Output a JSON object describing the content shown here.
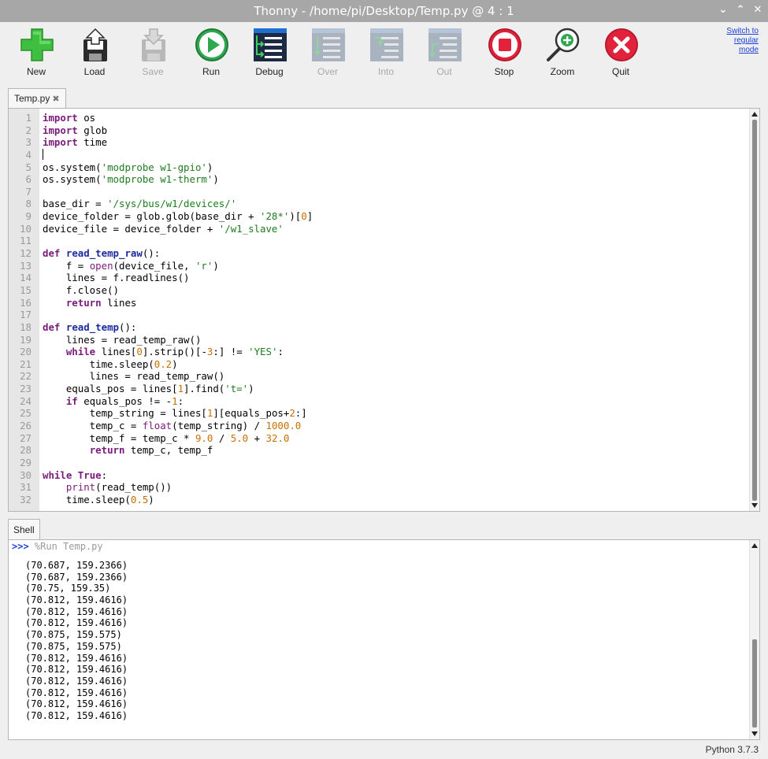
{
  "window": {
    "title": "Thonny  -  /home/pi/Desktop/Temp.py  @  4 : 1",
    "controls": [
      "⌄",
      "⌃",
      "✕"
    ]
  },
  "toolbar": {
    "buttons": [
      {
        "label": "New",
        "icon": "new-file-icon",
        "enabled": true
      },
      {
        "label": "Load",
        "icon": "load-icon",
        "enabled": true
      },
      {
        "label": "Save",
        "icon": "save-icon",
        "enabled": false
      },
      {
        "label": "Run",
        "icon": "run-icon",
        "enabled": true
      },
      {
        "label": "Debug",
        "icon": "debug-icon",
        "enabled": true
      },
      {
        "label": "Over",
        "icon": "step-over-icon",
        "enabled": false
      },
      {
        "label": "Into",
        "icon": "step-into-icon",
        "enabled": false
      },
      {
        "label": "Out",
        "icon": "step-out-icon",
        "enabled": false
      },
      {
        "label": "Stop",
        "icon": "stop-icon",
        "enabled": true
      },
      {
        "label": "Zoom",
        "icon": "zoom-icon",
        "enabled": true
      },
      {
        "label": "Quit",
        "icon": "quit-icon",
        "enabled": true
      }
    ],
    "switch_mode": [
      "Switch to",
      "regular",
      "mode"
    ]
  },
  "editor": {
    "tab_label": "Temp.py",
    "tab_close": "✖",
    "lines": [
      "import os",
      "import glob",
      "import time",
      "",
      "os.system('modprobe w1-gpio')",
      "os.system('modprobe w1-therm')",
      "",
      "base_dir = '/sys/bus/w1/devices/'",
      "device_folder = glob.glob(base_dir + '28*')[0]",
      "device_file = device_folder + '/w1_slave'",
      "",
      "def read_temp_raw():",
      "    f = open(device_file, 'r')",
      "    lines = f.readlines()",
      "    f.close()",
      "    return lines",
      "",
      "def read_temp():",
      "    lines = read_temp_raw()",
      "    while lines[0].strip()[-3:] != 'YES':",
      "        time.sleep(0.2)",
      "        lines = read_temp_raw()",
      "    equals_pos = lines[1].find('t=')",
      "    if equals_pos != -1:",
      "        temp_string = lines[1][equals_pos+2:]",
      "        temp_c = float(temp_string) / 1000.0",
      "        temp_f = temp_c * 9.0 / 5.0 + 32.0",
      "        return temp_c, temp_f",
      "",
      "while True:",
      "    print(read_temp())",
      "    time.sleep(0.5)"
    ]
  },
  "shell": {
    "tab_label": "Shell",
    "prompt": ">>>",
    "command": "%Run Temp.py",
    "output": [
      "(70.687, 159.2366)",
      "(70.687, 159.2366)",
      "(70.75, 159.35)",
      "(70.812, 159.4616)",
      "(70.812, 159.4616)",
      "(70.812, 159.4616)",
      "(70.875, 159.575)",
      "(70.875, 159.575)",
      "(70.812, 159.4616)",
      "(70.812, 159.4616)",
      "(70.812, 159.4616)",
      "(70.812, 159.4616)",
      "(70.812, 159.4616)",
      "(70.812, 159.4616)"
    ]
  },
  "status": {
    "python_version": "Python 3.7.3"
  },
  "colors": {
    "titlebar": "#a7a7a7",
    "keyword": "#7a1b7a",
    "function_name": "#1c2aa0",
    "string": "#1e7b1e",
    "number": "#c87000",
    "prompt": "#1a3fd8"
  }
}
